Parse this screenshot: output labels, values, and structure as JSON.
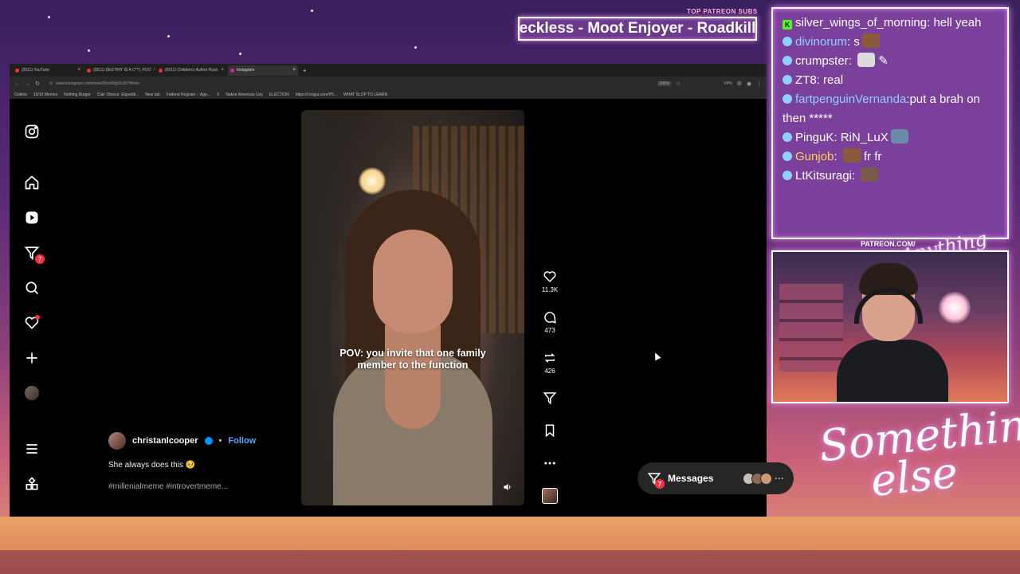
{
  "overlay": {
    "patreon_heading": "TOP PATREON SUBS",
    "patreon_names": "eckless - Moot Enjoyer - Roadkill",
    "patreon_url": "PATREON.COM/",
    "cam_signature": "Anything else?",
    "stream_signature": "Something else",
    "accent_color": "#ee8cff"
  },
  "browser": {
    "tabs": [
      {
        "label": "(9511) YouTube",
        "active": false
      },
      {
        "label": "(9511) DESTINY IS A C**T, FOO",
        "active": false
      },
      {
        "label": "(9511) Children's Author Ryan",
        "active": false
      },
      {
        "label": "Instagram",
        "active": true
      }
    ],
    "url": "www.instagram.com/reels/DbsxDg6XLB/?hl=en",
    "zoom": "200%",
    "vpn_label": "VPN",
    "bookmarks": [
      "Outlets",
      "10/10 Memes",
      "Nothing Burger",
      "Clair Obscur: Expediti...",
      "New tab",
      "Federal Register :: Age...",
      "X",
      "Native American Usy",
      "ELECTION",
      "https://i.imgur.com/P5...",
      "WHAT SLOP TO LEARN"
    ]
  },
  "instagram": {
    "messages_badge": "7",
    "reel_caption": "POV: you invite that one family member to the function",
    "likes": "11.3K",
    "comments": "473",
    "reposts": "426",
    "username": "christanlcooper",
    "follow_label": "Follow",
    "description": "She always does this 🥺",
    "hashtags": "#millenialmeme #introvertmeme...",
    "messages_label": "Messages",
    "more_avatars": "···"
  },
  "chat": {
    "messages": [
      {
        "user": "silver_wings_of_morning",
        "text": "hell yeah",
        "prefix": "K",
        "color": "white"
      },
      {
        "user": "divinorum",
        "text": "s",
        "color": "blue",
        "emote": true
      },
      {
        "user": "crumpster",
        "text": "",
        "color": "white",
        "emote": true
      },
      {
        "user": "ZT8",
        "text": "real",
        "color": "white"
      },
      {
        "user": "fartpenguinVernanda",
        "text": "put a brah on then *****",
        "color": "blue"
      },
      {
        "user": "PinguK",
        "text": "RiN_LuX",
        "color": "white",
        "emote": true
      },
      {
        "user": "Gunjob",
        "text": "fr fr",
        "color": "gold",
        "emote": true
      },
      {
        "user": "LtKitsuragi",
        "text": "",
        "color": "white",
        "emote": true
      }
    ]
  }
}
